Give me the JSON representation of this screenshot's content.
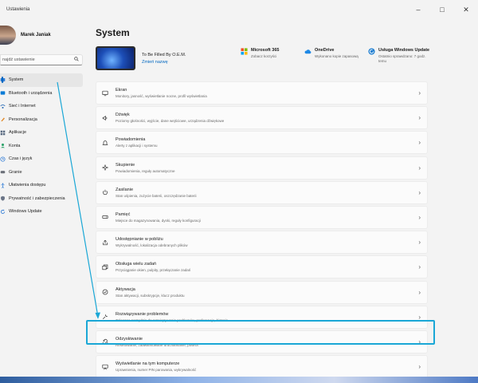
{
  "window": {
    "title": "Ustawienia"
  },
  "profile": {
    "name": "Marek Janiak"
  },
  "search": {
    "placeholder": "najdź ustawienie"
  },
  "sidebar": {
    "items": [
      {
        "label": "System",
        "icon": "monitor-icon",
        "active": true
      },
      {
        "label": "Bluetooth i urządzenia",
        "icon": "bluetooth-icon"
      },
      {
        "label": "Sieć i Internet",
        "icon": "network-icon"
      },
      {
        "label": "Personalizacja",
        "icon": "brush-icon"
      },
      {
        "label": "Aplikacje",
        "icon": "apps-icon"
      },
      {
        "label": "Konta",
        "icon": "person-icon"
      },
      {
        "label": "Czas i język",
        "icon": "clock-icon"
      },
      {
        "label": "Granie",
        "icon": "gamepad-icon"
      },
      {
        "label": "Ułatwienia dostępu",
        "icon": "accessibility-icon"
      },
      {
        "label": "Prywatność i zabezpieczenia",
        "icon": "shield-icon"
      },
      {
        "label": "Windows Update",
        "icon": "update-icon"
      }
    ]
  },
  "main": {
    "title": "System",
    "device": {
      "name": "To Be Filled By O.E.M.",
      "rename": "Zmień nazwę"
    },
    "tiles": [
      {
        "title": "Microsoft 365",
        "sub": "Zobacz korzyści",
        "icon": "microsoft-logo-icon"
      },
      {
        "title": "OneDrive",
        "sub": "Wykonano kopie zapasową",
        "icon": "cloud-icon"
      },
      {
        "title": "Usługa Windows Update",
        "sub": "Ostatnio sprawdzano: 7 godz. temu",
        "icon": "update-icon"
      }
    ],
    "cards": [
      {
        "title": "Ekran",
        "sub": "Monitory, jasność, wyświetlanie nocne, profil wyświetlania",
        "icon": "monitor-icon"
      },
      {
        "title": "Dźwięk",
        "sub": "Poziomy głośności, wyjście, dane wejściowe, urządzenia dźwiękowe",
        "icon": "speaker-icon"
      },
      {
        "title": "Powiadomienia",
        "sub": "Alerty z aplikacji i systemu",
        "icon": "bell-icon"
      },
      {
        "title": "Skupienie",
        "sub": "Powiadomienia, reguły automatyczne",
        "icon": "focus-icon"
      },
      {
        "title": "Zasilanie",
        "sub": "Stan uśpienia, zużycie baterii, oszczędzanie baterii",
        "icon": "power-icon"
      },
      {
        "title": "Pamięć",
        "sub": "Miejsce do magazynowania, dyski, reguły konfiguracji",
        "icon": "storage-icon"
      },
      {
        "title": "Udostępnianie w pobliżu",
        "sub": "Wykrywalność, lokalizacja odebranych plików",
        "icon": "share-icon"
      },
      {
        "title": "Obsługa wielu zadań",
        "sub": "Przyciąganie okien, pulpity, przełączanie zadań",
        "icon": "multitask-icon"
      },
      {
        "title": "Aktywacja",
        "sub": "Stan aktywacji, subskrypcje, klucz produktu",
        "icon": "check-circle-icon"
      },
      {
        "title": "Rozwiązywanie problemów",
        "sub": "Zalecane narzędzia do rozwiązywania problemów, preferencje, historia",
        "icon": "wrench-icon"
      },
      {
        "title": "Odzyskiwanie",
        "sub": "Resetowanie, zaawansowane uruchamianie, powrót",
        "icon": "recovery-icon"
      },
      {
        "title": "Wyświetlanie na tym komputerze",
        "sub": "Uprawnienia, numer PIN parowania, wykrywalność",
        "icon": "project-icon"
      }
    ]
  },
  "colors": {
    "accent": "#0067c0",
    "highlight": "#1aa7d6"
  }
}
